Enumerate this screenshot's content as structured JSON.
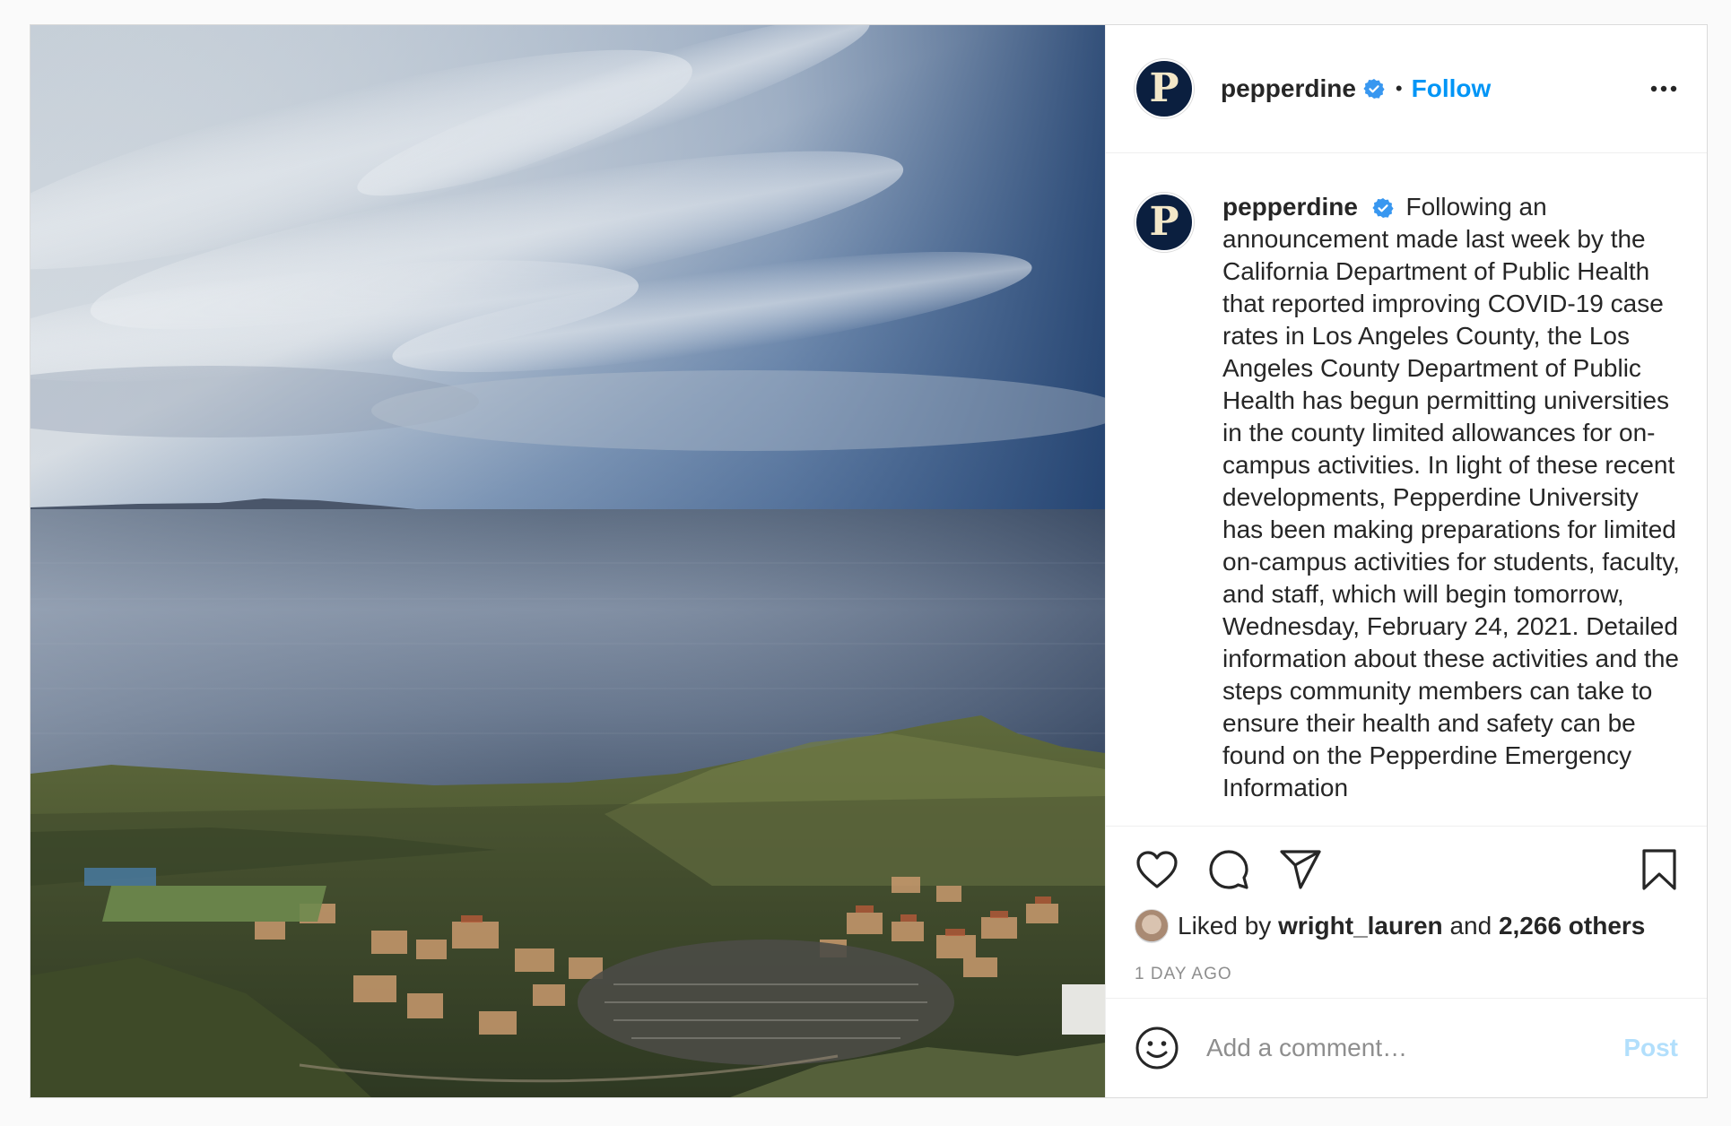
{
  "post": {
    "image_alt": "Aerial view of Pepperdine University campus overlooking the Pacific Ocean under a cloudy sky"
  },
  "header": {
    "avatar_letter": "P",
    "username": "pepperdine",
    "verified_icon": "verified-badge-icon",
    "separator": "•",
    "follow_label": "Follow",
    "more_icon": "more-options-icon"
  },
  "caption": {
    "avatar_letter": "P",
    "username": "pepperdine",
    "text": "Following an announcement made last week by the California Department of Public Health that reported improving COVID-19 case rates in Los Angeles County, the Los Angeles County Department of Public Health has begun permitting universities in the county limited allowances for on-campus activities. In light of these recent developments, Pepperdine University has been making preparations for limited on-campus activities for students, faculty, and staff, which will begin tomorrow, Wednesday, February 24, 2021. Detailed information about these activities and the steps community members can take to ensure their health and safety can be found on the Pepperdine Emergency Information"
  },
  "actions": {
    "like_icon": "heart-icon",
    "comment_icon": "comment-icon",
    "share_icon": "share-icon",
    "save_icon": "bookmark-icon"
  },
  "likes": {
    "prefix": "Liked by",
    "user": "wright_lauren",
    "and": "and",
    "others": "2,266 others"
  },
  "time_ago": "1 DAY AGO",
  "comment": {
    "placeholder": "Add a comment…",
    "post_label": "Post"
  },
  "colors": {
    "accent": "#0095f6",
    "post_disabled": "#b2dffc",
    "brand_navy": "#0b1f3f"
  }
}
